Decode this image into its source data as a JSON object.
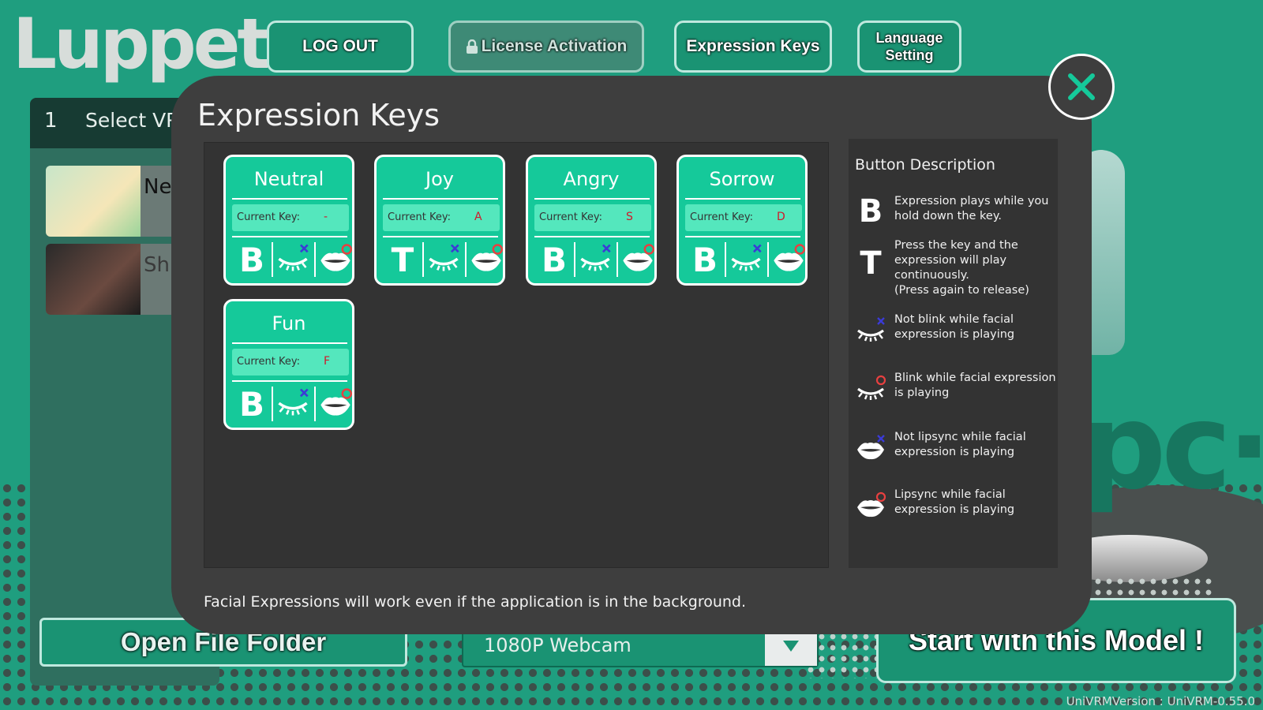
{
  "app": {
    "logo": "Luppet"
  },
  "top_buttons": {
    "logout": "LOG OUT",
    "license": "License Activation",
    "expression_keys": "Expression Keys",
    "language_line1": "Language",
    "language_line2": "Setting"
  },
  "background": {
    "step_number": "1",
    "step_label": "Select VRM",
    "models": [
      {
        "name": "Nea"
      },
      {
        "name": "Shi"
      }
    ],
    "open_folder": "Open File Folder",
    "webcam": "1080P Webcam",
    "start": "Start with this Model !",
    "version": "UniVRMVersion : UniVRM-0.55.0"
  },
  "modal": {
    "title": "Expression Keys",
    "current_key_label": "Current Key:",
    "footer": "Facial Expressions will work even if the application is in the background.",
    "expressions": [
      {
        "name": "Neutral",
        "key": "-",
        "mode": "B"
      },
      {
        "name": "Joy",
        "key": "A",
        "mode": "T"
      },
      {
        "name": "Angry",
        "key": "S",
        "mode": "B"
      },
      {
        "name": "Sorrow",
        "key": "D",
        "mode": "B"
      },
      {
        "name": "Fun",
        "key": "F",
        "mode": "B"
      }
    ],
    "description": {
      "title": "Button Description",
      "items": [
        {
          "icon": "B",
          "text": "Expression plays while you hold down the key."
        },
        {
          "icon": "T",
          "text": "Press the key and the expression will play continuously.\n (Press again to release)"
        },
        {
          "icon": "eye-blink-off-icon",
          "text": "Not blink while facial expression is playing"
        },
        {
          "icon": "eye-blink-on-icon",
          "text": "Blink while facial expression is playing"
        },
        {
          "icon": "lips-sync-off-icon",
          "text": "Not lipsync while facial expression is playing"
        },
        {
          "icon": "lips-sync-on-icon",
          "text": "Lipsync while facial expression is playing"
        }
      ]
    }
  },
  "colors": {
    "background": "#1f9e7f",
    "card": "#15c99a",
    "key_value": "#d0182a",
    "modal": "#3e3e3e",
    "cross_mark": "#3b3bd6",
    "circle_mark": "#e84040"
  }
}
